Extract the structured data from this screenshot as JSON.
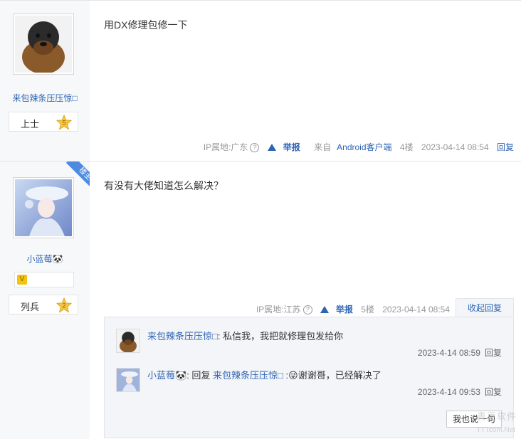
{
  "posts": [
    {
      "username": "来包辣条压压惊□",
      "rank": "上士",
      "level": "5",
      "content": "用DX修理包修一下",
      "ip": "IP属地:广东",
      "report": "举报",
      "source_prefix": "来自",
      "source_app": "Android客户端",
      "floor": "4楼",
      "time": "2023-04-14 08:54",
      "reply": "回复"
    },
    {
      "corner_label": "楼主",
      "username": "小蓝莓🐼",
      "rank": "列兵",
      "level": "2",
      "content": "有没有大佬知道怎么解决？",
      "ip": "IP属地:江苏",
      "report": "举报",
      "floor": "5楼",
      "time": "2023-04-14 08:54",
      "collapse": "收起回复"
    }
  ],
  "subreplies": [
    {
      "name": "来包辣条压压惊□",
      "colon": ":",
      "text": " 私信我，我把就修理包发给你",
      "time": "2023-4-14 08:59",
      "reply": "回复"
    },
    {
      "name": "小蓝莓🐼",
      "colon": ":",
      "reply_prefix": " 回复 ",
      "target": "来包辣条压压惊□",
      "emoji": "😜",
      "text": "谢谢哥，已经解决了",
      "time": "2023-4-14 09:53",
      "reply": "回复"
    }
  ],
  "say_button": "我也说一句",
  "watermark": "青豆软件",
  "watermark_url": "TTTcom.Net",
  "colors": {
    "link": "#2d64b3",
    "sidebar": "#f7f8fa",
    "subbox": "#f3f5f8",
    "corner": "#4e8be0"
  }
}
